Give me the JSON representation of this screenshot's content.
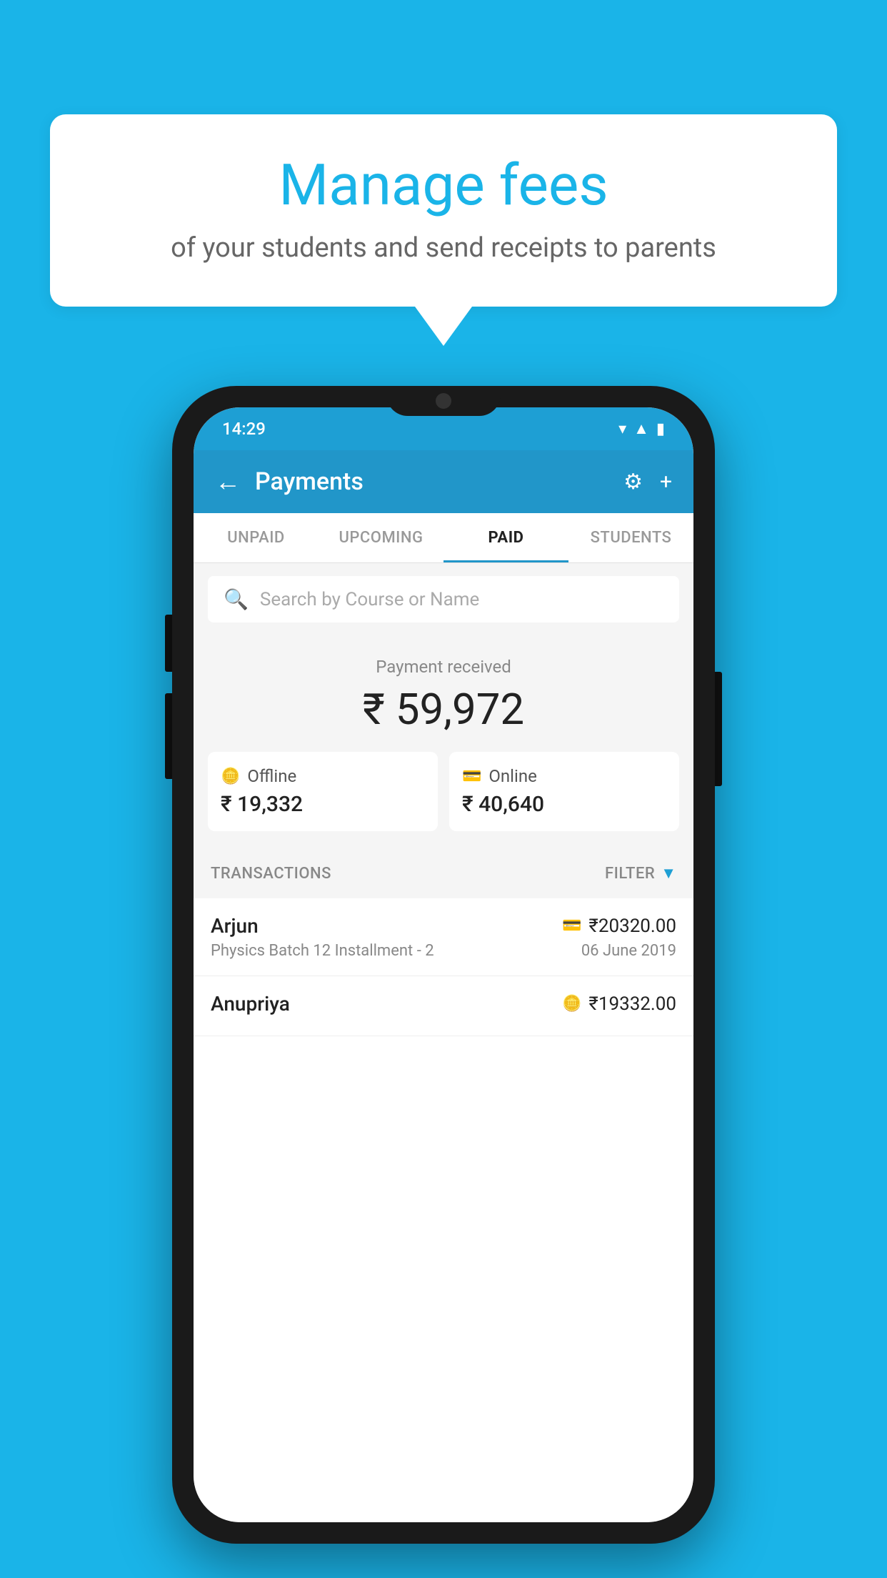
{
  "background_color": "#1ab4e8",
  "speech_bubble": {
    "title": "Manage fees",
    "subtitle": "of your students and send receipts to parents"
  },
  "status_bar": {
    "time": "14:29",
    "wifi": "▼",
    "signal": "▲",
    "battery": "▌"
  },
  "app_bar": {
    "title": "Payments",
    "back_label": "←",
    "gear_label": "⚙",
    "plus_label": "+"
  },
  "tabs": [
    {
      "label": "UNPAID",
      "active": false
    },
    {
      "label": "UPCOMING",
      "active": false
    },
    {
      "label": "PAID",
      "active": true
    },
    {
      "label": "STUDENTS",
      "active": false
    }
  ],
  "search": {
    "placeholder": "Search by Course or Name"
  },
  "payment_summary": {
    "label": "Payment received",
    "amount": "₹ 59,972",
    "offline": {
      "label": "Offline",
      "amount": "₹ 19,332"
    },
    "online": {
      "label": "Online",
      "amount": "₹ 40,640"
    }
  },
  "transactions": {
    "header_label": "TRANSACTIONS",
    "filter_label": "FILTER",
    "items": [
      {
        "name": "Arjun",
        "course": "Physics Batch 12 Installment - 2",
        "amount": "₹20320.00",
        "date": "06 June 2019",
        "payment_type": "card"
      },
      {
        "name": "Anupriya",
        "course": "",
        "amount": "₹19332.00",
        "date": "",
        "payment_type": "offline"
      }
    ]
  }
}
